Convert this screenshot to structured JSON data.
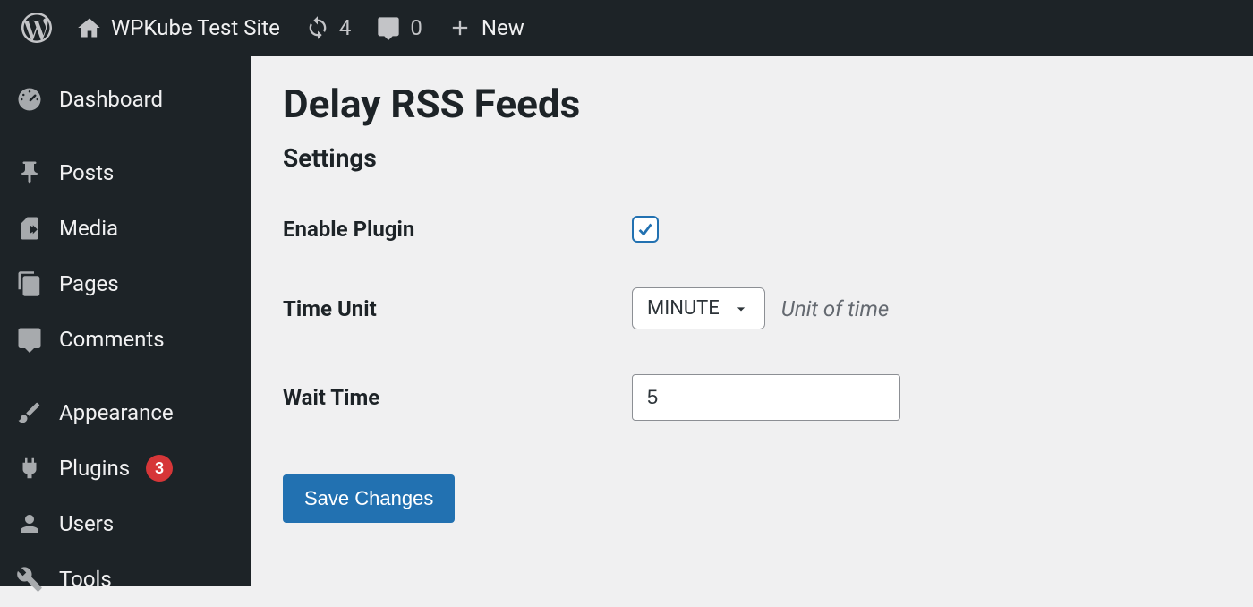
{
  "adminbar": {
    "site_name": "WPKube Test Site",
    "updates_count": "4",
    "comments_count": "0",
    "new_label": "New"
  },
  "sidebar": {
    "items": [
      {
        "label": "Dashboard"
      },
      {
        "label": "Posts"
      },
      {
        "label": "Media"
      },
      {
        "label": "Pages"
      },
      {
        "label": "Comments"
      },
      {
        "label": "Appearance"
      },
      {
        "label": "Plugins",
        "badge": "3"
      },
      {
        "label": "Users"
      },
      {
        "label": "Tools"
      }
    ]
  },
  "main": {
    "page_title": "Delay RSS Feeds",
    "section_title": "Settings",
    "enable_label": "Enable Plugin",
    "enable_checked": true,
    "time_unit_label": "Time Unit",
    "time_unit_value": "MINUTE",
    "time_unit_desc": "Unit of time",
    "wait_time_label": "Wait Time",
    "wait_time_value": "5",
    "save_label": "Save Changes"
  }
}
